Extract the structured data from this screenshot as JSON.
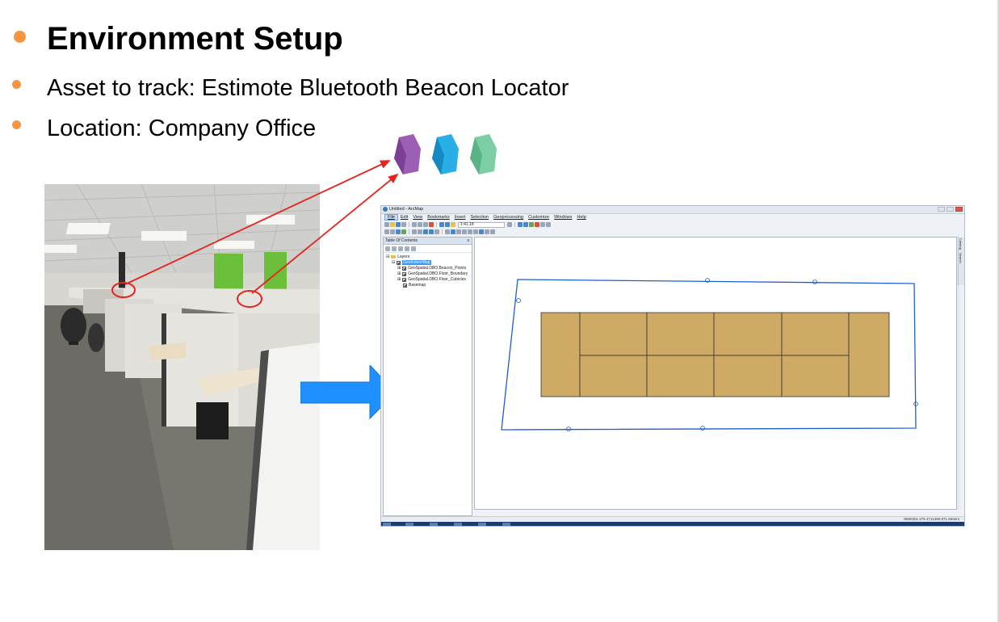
{
  "slide": {
    "title": "Environment Setup",
    "bullets": [
      "Asset to track: Estimote Bluetooth Beacon Locator",
      "Location: Company Office"
    ],
    "colors": {
      "bullet": "#f7953e",
      "annotation_red": "#e8231c",
      "flow_arrow": "#1e90ff"
    }
  },
  "beacons": {
    "colors": [
      "#9b5fb5",
      "#29aee6",
      "#7ccfa4"
    ]
  },
  "arcmap": {
    "window_title": "Untitled - ArcMap",
    "menu": [
      "File",
      "Edit",
      "View",
      "Bookmarks",
      "Insert",
      "Selection",
      "Geoprocessing",
      "Customize",
      "Windows",
      "Help"
    ],
    "active_menu": "File",
    "scale": "1:41.18",
    "toc": {
      "title": "Table Of Contents",
      "close": "x",
      "root": "Layers",
      "selected_layer": "GeoIndoorMap",
      "layers": [
        "GeoSpatial.DBO.Beacon_Points",
        "GeoSpatial.DBO.Floor_Boundary",
        "GeoSpatial.DBO.Floor_Cubicles",
        "Basemap"
      ]
    },
    "side_tabs": [
      "Catalog",
      "Search"
    ],
    "coordinates": "-8590301.275  4711480.871 Meters",
    "map": {
      "boundary_color": "#1f5fd1",
      "cubicle_fill": "#cfaa64",
      "cubicle_stroke": "#333333"
    }
  }
}
